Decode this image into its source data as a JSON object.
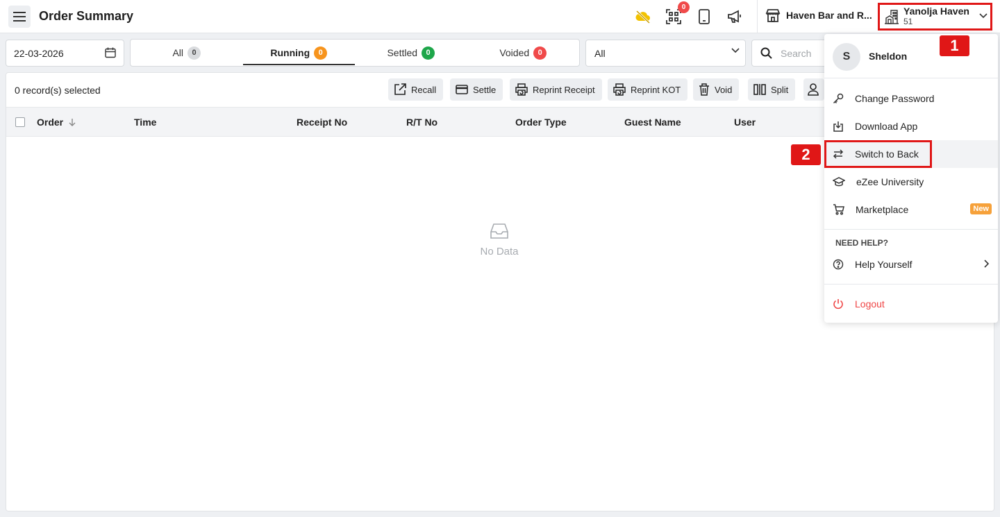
{
  "header": {
    "title": "Order Summary",
    "notification_count": "0",
    "outlet_name": "Haven Bar and R...",
    "property_name": "Yanolja Haven",
    "property_code": "51"
  },
  "filters": {
    "date": "22-03-2026",
    "tabs": [
      {
        "label": "All",
        "count": "0",
        "color": "#d9dbde"
      },
      {
        "label": "Running",
        "count": "0",
        "color": "#f7941d"
      },
      {
        "label": "Settled",
        "count": "0",
        "color": "#1ea64a"
      },
      {
        "label": "Voided",
        "count": "0",
        "color": "#f04a4a"
      }
    ],
    "select_value": "All",
    "search_placeholder": "Search"
  },
  "toolbar": {
    "records_selected": "0 record(s) selected",
    "recall": "Recall",
    "settle": "Settle",
    "reprint_receipt": "Reprint Receipt",
    "reprint_kot": "Reprint KOT",
    "void": "Void",
    "split": "Split"
  },
  "table": {
    "columns": [
      "Order",
      "Time",
      "Receipt No",
      "R/T No",
      "Order Type",
      "Guest Name",
      "User"
    ],
    "empty_text": "No Data"
  },
  "user_menu": {
    "avatar_letter": "S",
    "user_name": "Sheldon",
    "items": [
      "Change Password",
      "Download App",
      "Switch to Back",
      "eZee University",
      "Marketplace"
    ],
    "new_badge": "New",
    "help_section": "NEED HELP?",
    "help_item": "Help Yourself",
    "logout": "Logout"
  },
  "annotations": {
    "step1": "1",
    "step2": "2",
    "color": "#e01717"
  }
}
